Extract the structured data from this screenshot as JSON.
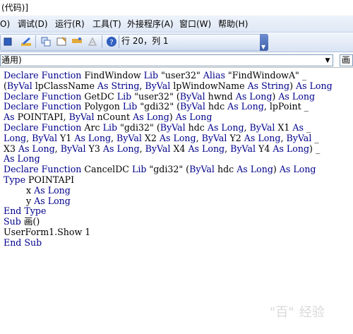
{
  "window": {
    "title_fragment": "(代码)]"
  },
  "menubar": {
    "items": [
      {
        "label": "O)"
      },
      {
        "label": "调试(D)"
      },
      {
        "label": "运行(R)"
      },
      {
        "label": "工具(T)"
      },
      {
        "label": "外接程序(A)"
      },
      {
        "label": "窗口(W)"
      },
      {
        "label": "帮助(H)"
      }
    ]
  },
  "toolbar": {
    "position_text": "行 20，列 1",
    "icons": [
      "stop-icon",
      "design-mode-icon",
      "project-explorer-icon",
      "properties-icon",
      "object-browser-icon",
      "toolbox-icon",
      "help-icon"
    ]
  },
  "dropdowns": {
    "object_value": "通用)",
    "procedure_value": "画"
  },
  "code": {
    "lines": [
      [
        {
          "t": "Declare Function ",
          "k": true
        },
        {
          "t": "FindWindow ",
          "k": false
        },
        {
          "t": "Lib ",
          "k": true
        },
        {
          "t": "\"user32\" ",
          "k": false
        },
        {
          "t": "Alias ",
          "k": true
        },
        {
          "t": "\"FindWindowA\" _",
          "k": false
        }
      ],
      [
        {
          "t": "(",
          "k": false
        },
        {
          "t": "ByVal ",
          "k": true
        },
        {
          "t": "lpClassName ",
          "k": false
        },
        {
          "t": "As String",
          "k": true
        },
        {
          "t": ", ",
          "k": false
        },
        {
          "t": "ByVal ",
          "k": true
        },
        {
          "t": "lpWindowName ",
          "k": false
        },
        {
          "t": "As String",
          "k": true
        },
        {
          "t": ") ",
          "k": false
        },
        {
          "t": "As Long",
          "k": true
        }
      ],
      [
        {
          "t": "Declare Function ",
          "k": true
        },
        {
          "t": "GetDC ",
          "k": false
        },
        {
          "t": "Lib ",
          "k": true
        },
        {
          "t": "\"user32\" (",
          "k": false
        },
        {
          "t": "ByVal ",
          "k": true
        },
        {
          "t": "hwnd ",
          "k": false
        },
        {
          "t": "As Long",
          "k": true
        },
        {
          "t": ") ",
          "k": false
        },
        {
          "t": "As Long",
          "k": true
        }
      ],
      [
        {
          "t": "Declare Function ",
          "k": true
        },
        {
          "t": "Polygon ",
          "k": false
        },
        {
          "t": "Lib ",
          "k": true
        },
        {
          "t": "\"gdi32\" (",
          "k": false
        },
        {
          "t": "ByVal ",
          "k": true
        },
        {
          "t": "hdc ",
          "k": false
        },
        {
          "t": "As Long",
          "k": true
        },
        {
          "t": ", lpPoint _",
          "k": false
        }
      ],
      [
        {
          "t": "As ",
          "k": true
        },
        {
          "t": "POINTAPI, ",
          "k": false
        },
        {
          "t": "ByVal ",
          "k": true
        },
        {
          "t": "nCount ",
          "k": false
        },
        {
          "t": "As Long",
          "k": true
        },
        {
          "t": ") ",
          "k": false
        },
        {
          "t": "As Long",
          "k": true
        }
      ],
      [
        {
          "t": "Declare Function ",
          "k": true
        },
        {
          "t": "Arc ",
          "k": false
        },
        {
          "t": "Lib ",
          "k": true
        },
        {
          "t": "\"gdi32\" (",
          "k": false
        },
        {
          "t": "ByVal ",
          "k": true
        },
        {
          "t": "hdc ",
          "k": false
        },
        {
          "t": "As Long",
          "k": true
        },
        {
          "t": ", ",
          "k": false
        },
        {
          "t": "ByVal ",
          "k": true
        },
        {
          "t": "X1 ",
          "k": false
        },
        {
          "t": "As ",
          "k": true
        },
        {
          "t": "_",
          "k": false
        }
      ],
      [
        {
          "t": "Long",
          "k": true
        },
        {
          "t": ", ",
          "k": false
        },
        {
          "t": "ByVal ",
          "k": true
        },
        {
          "t": "Y1 ",
          "k": false
        },
        {
          "t": "As Long",
          "k": true
        },
        {
          "t": ", ",
          "k": false
        },
        {
          "t": "ByVal ",
          "k": true
        },
        {
          "t": "X2 ",
          "k": false
        },
        {
          "t": "As Long",
          "k": true
        },
        {
          "t": ", ",
          "k": false
        },
        {
          "t": "ByVal ",
          "k": true
        },
        {
          "t": "Y2 ",
          "k": false
        },
        {
          "t": "As Long",
          "k": true
        },
        {
          "t": ", ",
          "k": false
        },
        {
          "t": "ByVal ",
          "k": true
        },
        {
          "t": "_",
          "k": false
        }
      ],
      [
        {
          "t": "X3 ",
          "k": false
        },
        {
          "t": "As Long",
          "k": true
        },
        {
          "t": ", ",
          "k": false
        },
        {
          "t": "ByVal ",
          "k": true
        },
        {
          "t": "Y3 ",
          "k": false
        },
        {
          "t": "As Long",
          "k": true
        },
        {
          "t": ", ",
          "k": false
        },
        {
          "t": "ByVal ",
          "k": true
        },
        {
          "t": "X4 ",
          "k": false
        },
        {
          "t": "As Long",
          "k": true
        },
        {
          "t": ", ",
          "k": false
        },
        {
          "t": "ByVal ",
          "k": true
        },
        {
          "t": "Y4 ",
          "k": false
        },
        {
          "t": "As Long",
          "k": true
        },
        {
          "t": ") _",
          "k": false
        }
      ],
      [
        {
          "t": "As Long",
          "k": true
        }
      ],
      [
        {
          "t": "Declare Function ",
          "k": true
        },
        {
          "t": "CancelDC ",
          "k": false
        },
        {
          "t": "Lib ",
          "k": true
        },
        {
          "t": "\"gdi32\" (",
          "k": false
        },
        {
          "t": "ByVal ",
          "k": true
        },
        {
          "t": "hdc ",
          "k": false
        },
        {
          "t": "As Long",
          "k": true
        },
        {
          "t": ") ",
          "k": false
        },
        {
          "t": "As Long",
          "k": true
        }
      ],
      [
        {
          "t": "Type ",
          "k": true
        },
        {
          "t": "POINTAPI",
          "k": false
        }
      ],
      [
        {
          "t": "        x ",
          "k": false
        },
        {
          "t": "As Long",
          "k": true
        }
      ],
      [
        {
          "t": "        y ",
          "k": false
        },
        {
          "t": "As Long",
          "k": true
        }
      ],
      [
        {
          "t": "End Type",
          "k": true
        }
      ],
      [
        {
          "t": "Sub ",
          "k": true
        },
        {
          "t": "画()",
          "k": false
        }
      ],
      [
        {
          "t": "UserForm1.Show 1",
          "k": false
        }
      ],
      [
        {
          "t": "End Sub",
          "k": true
        }
      ]
    ]
  },
  "watermark": {
    "text": "\"百\"  经验"
  }
}
